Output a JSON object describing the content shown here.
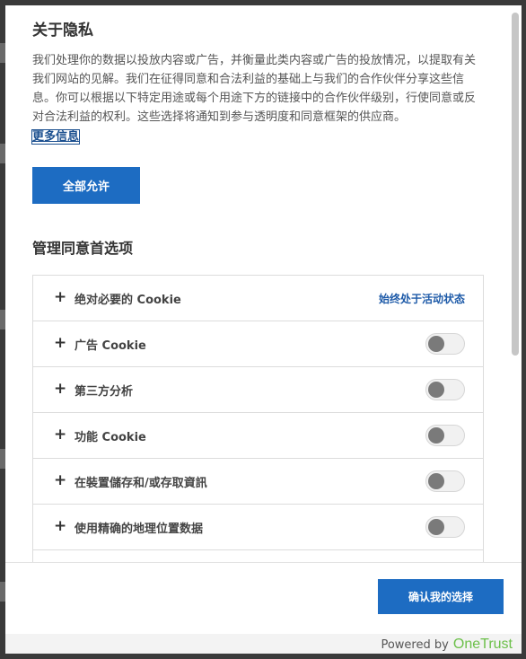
{
  "privacy": {
    "title": "关于隐私",
    "description": "我们处理你的数据以投放内容或广告，并衡量此类内容或广告的投放情况，以提取有关我们网站的见解。我们在征得同意和合法利益的基础上与我们的合作伙伴分享这些信息。你可以根据以下特定用途或每个用途下方的链接中的合作伙伴级别，行使同意或反对合法利益的权利。这些选择将通知到参与透明度和同意框架的供应商。",
    "more_info": "更多信息",
    "allow_all": "全部允许"
  },
  "manage": {
    "title": "管理同意首选项",
    "categories": [
      {
        "label": "绝对必要的 Cookie",
        "status": "始终处于活动状态",
        "enabled": true
      },
      {
        "label": "广告 Cookie",
        "enabled": false
      },
      {
        "label": "第三方分析",
        "enabled": false
      },
      {
        "label": "功能 Cookie",
        "enabled": false
      },
      {
        "label": "在裝置儲存和/或存取資訊",
        "enabled": false
      },
      {
        "label": "使用精确的地理位置数据",
        "enabled": false
      }
    ]
  },
  "footer": {
    "confirm": "确认我的选择",
    "powered_by": "Powered by",
    "brand": "OneTrust"
  },
  "icons": {
    "expand": "plus-icon"
  },
  "colors": {
    "primary": "#1d6cc2",
    "link": "#1a4f8f",
    "brand": "#6cc04a",
    "toggle_knob_off": "#7a7a7a"
  }
}
